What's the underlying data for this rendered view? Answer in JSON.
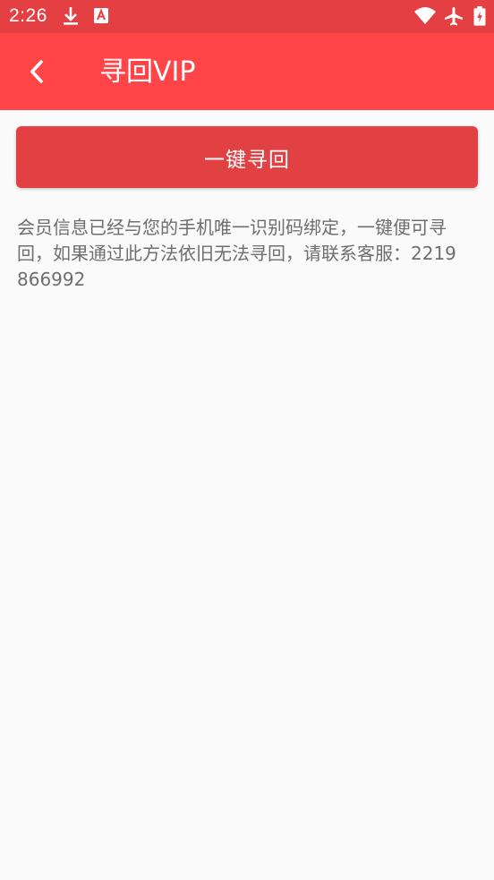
{
  "status_bar": {
    "time": "2:26",
    "icons": [
      "download-icon",
      "a-icon",
      "wifi-icon",
      "airplane-icon",
      "battery-charging-icon"
    ]
  },
  "app_bar": {
    "title": "寻回VIP",
    "back_icon": "chevron-left-icon"
  },
  "main": {
    "recover_button_label": "一键寻回",
    "info_text": "会员信息已经与您的手机唯一识别码绑定，一键便可寻回，如果通过此方法依旧无法寻回，请联系客服：2219866992"
  },
  "colors": {
    "status_bar": "#e43f42",
    "app_bar": "#ff4547",
    "button": "#e24144",
    "background": "#fafafa",
    "body_text": "#6e6e6e"
  }
}
